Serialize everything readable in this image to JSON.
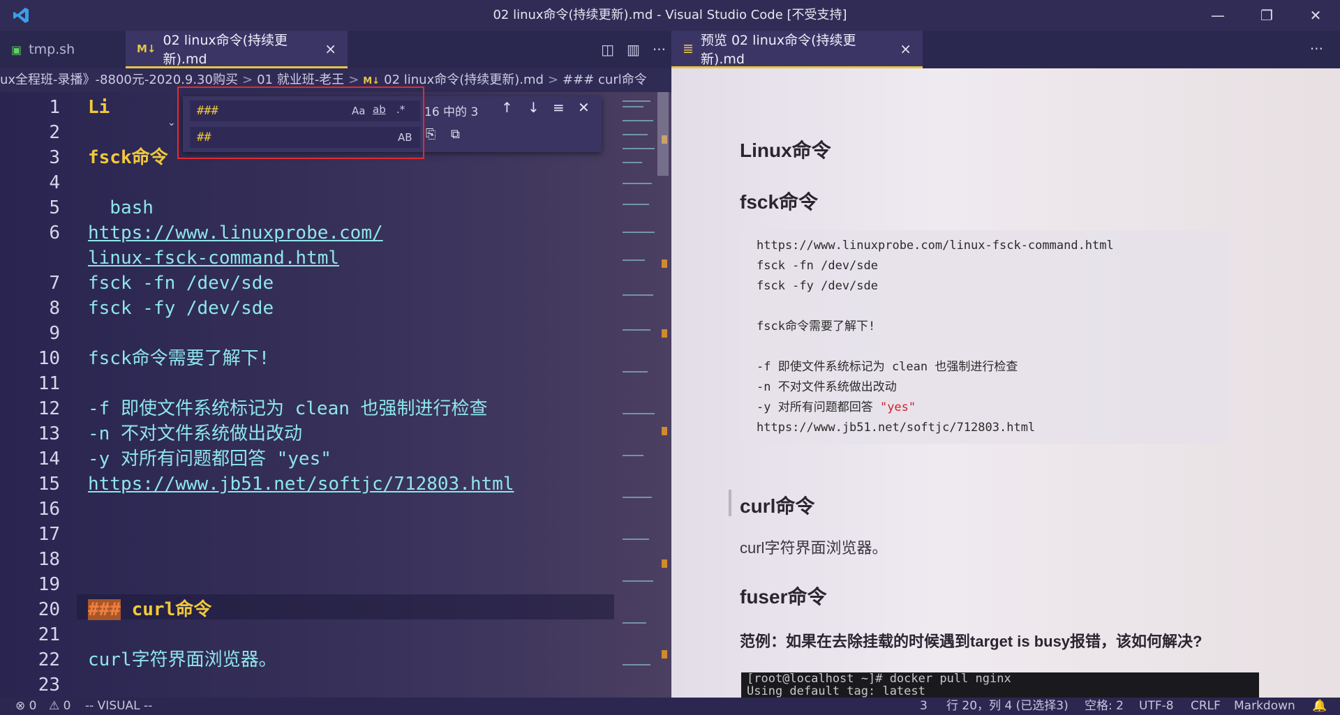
{
  "window": {
    "title": "02 linux命令(持续更新).md - Visual Studio Code [不受支持]",
    "controls": [
      "minimize-icon",
      "restore-icon",
      "close-icon"
    ]
  },
  "tabs_left": [
    {
      "label": "tmp.sh",
      "icon": "terminal-icon"
    },
    {
      "label": "02 linux命令(持续更新).md",
      "icon": "markdown-icon",
      "close": "×"
    }
  ],
  "tab_actions": [
    "open-preview-icon",
    "split-editor-icon",
    "more-icon"
  ],
  "tabs_right": {
    "label": "预览 02 linux命令(持续更新).md",
    "icon": "preview-icon",
    "close": "×",
    "more": "···"
  },
  "breadcrumb": [
    "ux全程班-录播》-8800元-2020.9.30购买",
    "01 就业班-老王",
    "02 linux命令(持续更新).md",
    "### curl命令"
  ],
  "find": {
    "search_value": "###",
    "replace_value": "##",
    "match_case": "Aa",
    "whole_word": "ab",
    "regex": ".*",
    "preserve_case": "AB",
    "count": "16 中的 3"
  },
  "editor_lines": [
    {
      "n": "1",
      "text": "Li"
    },
    {
      "n": "2",
      "text": ""
    },
    {
      "n": "3",
      "text": "fsck命令"
    },
    {
      "n": "4",
      "text": ""
    },
    {
      "n": "5",
      "text": "  bash"
    },
    {
      "n": "6",
      "text": "https://www.linuxprobe.com/"
    },
    {
      "n": "",
      "text": "linux-fsck-command.html"
    },
    {
      "n": "7",
      "text": "fsck -fn /dev/sde"
    },
    {
      "n": "8",
      "text": "fsck -fy /dev/sde"
    },
    {
      "n": "9",
      "text": ""
    },
    {
      "n": "10",
      "text": "fsck命令需要了解下!"
    },
    {
      "n": "11",
      "text": ""
    },
    {
      "n": "12",
      "text": "-f 即使文件系统标记为 clean 也强制进行检查"
    },
    {
      "n": "13",
      "text": "-n 不对文件系统做出改动"
    },
    {
      "n": "14",
      "text": "-y 对所有问题都回答 \"yes\""
    },
    {
      "n": "15",
      "text": "https://www.jb51.net/softjc/712803.html"
    },
    {
      "n": "16",
      "text": ""
    },
    {
      "n": "17",
      "text": ""
    },
    {
      "n": "18",
      "text": ""
    },
    {
      "n": "19",
      "text": ""
    },
    {
      "n": "20",
      "text": "curl命令",
      "hash": "###"
    },
    {
      "n": "21",
      "text": ""
    },
    {
      "n": "22",
      "text": "curl字符界面浏览器。"
    },
    {
      "n": "23",
      "text": ""
    }
  ],
  "preview": {
    "h1": "Linux命令",
    "h2_fsck": "fsck命令",
    "code_lines": [
      "https://www.linuxprobe.com/linux-fsck-command.html",
      "fsck -fn /dev/sde",
      "fsck -fy /dev/sde",
      "",
      "fsck命令需要了解下!",
      "",
      "-f 即使文件系统标记为 clean 也强制进行检查",
      "-n 不对文件系统做出改动",
      "-y 对所有问题都回答 ",
      "https://www.jb51.net/softjc/712803.html"
    ],
    "yes_string": "\"yes\"",
    "h2_curl": "curl命令",
    "p_curl": "curl字符界面浏览器。",
    "h2_fuser": "fuser命令",
    "example": "范例：如果在去除挂载的时候遇到target is busy报错，该如何解决?",
    "terminal_line1": "[root@localhost ~]# docker pull nginx",
    "terminal_line2": "Using default tag: latest"
  },
  "statusbar": {
    "errors": "⊗ 0",
    "warnings": "⚠ 0",
    "mode": "-- VISUAL --",
    "selection_count": "3",
    "position": "行 20，列 4 (已选择3)",
    "indent": "空格: 2",
    "encoding": "UTF-8",
    "eol": "CRLF",
    "language": "Markdown"
  },
  "colors": {
    "accent": "#e8c545",
    "link": "#8fe6ea",
    "heading": "#f3c93a",
    "find_border": "#e22c2c"
  }
}
